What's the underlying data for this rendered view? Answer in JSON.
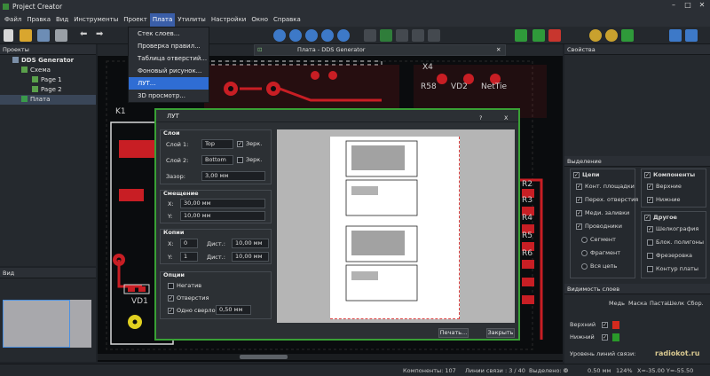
{
  "app": {
    "title": "Project Creator"
  },
  "menu": [
    "Файл",
    "Правка",
    "Вид",
    "Инструменты",
    "Проект",
    "Плата",
    "Утилиты",
    "Настройки",
    "Окно",
    "Справка"
  ],
  "plata_menu": [
    "Стек слоев...",
    "Проверка правил...",
    "Таблица отверстий...",
    "Фоновый рисунок...",
    "ЛУТ...",
    "3D просмотр..."
  ],
  "projects": {
    "title": "Проекты",
    "tree": [
      {
        "label": "DDS Generator",
        "bold": true
      },
      {
        "label": "Схема"
      },
      {
        "label": "Page 1"
      },
      {
        "label": "Page 2"
      },
      {
        "label": "Плата",
        "selected": true
      }
    ]
  },
  "view_panel": {
    "title": "Вид"
  },
  "doc_tab": {
    "label": "Плата - DDS Generator"
  },
  "pcb_labels": [
    "X4",
    "R58",
    "VD2",
    "NetTie",
    "K1",
    "VD1",
    "R2",
    "R3",
    "R4",
    "R5",
    "R6"
  ],
  "dialog": {
    "title": "ЛУТ",
    "help": "?",
    "close": "X",
    "layers": {
      "title": "Слои",
      "layer1_label": "Слой 1:",
      "layer1_value": "Top",
      "mirror1_label": "Зерк.",
      "layer2_label": "Слой 2:",
      "layer2_value": "Bottom",
      "mirror2_label": "Зерк.",
      "gap_label": "Зазор:",
      "gap_value": "3,00 мм"
    },
    "offset": {
      "title": "Смещение",
      "x_label": "X:",
      "x_value": "30,00 мм",
      "y_label": "Y:",
      "y_value": "10,00 мм"
    },
    "copies": {
      "title": "Копии",
      "x_label": "X:",
      "x_value": "0",
      "dx_label": "Дист.:",
      "dx_value": "10,00 мм",
      "y_label": "Y:",
      "y_value": "1",
      "dy_label": "Дист.:",
      "dy_value": "10,00 мм"
    },
    "options": {
      "title": "Опции",
      "negative_label": "Негатив",
      "holes_label": "Отверстия",
      "one_drill_label": "Одно сверло",
      "one_drill_value": "0,50 мм"
    },
    "print_button": "Печать...",
    "close_button": "Закрыть"
  },
  "properties": {
    "title": "Свойства"
  },
  "selection": {
    "title": "Выделение",
    "chains_title": "Цепи",
    "chains": [
      "Конт. площадки",
      "Перех. отверстия",
      "Меди. заливки",
      "Проводники",
      "Сегмент",
      "Фрагмент",
      "Вся цепь"
    ],
    "components_title": "Компоненты",
    "components": [
      "Верхние",
      "Нижние"
    ],
    "other_title": "Другое",
    "other": [
      "Шелкография",
      "Блок. полигоны",
      "Фрезеровка",
      "Контур платы"
    ]
  },
  "layer_visibility": {
    "title": "Видимость слоев",
    "columns": [
      "Медь",
      "Маска",
      "Паста",
      "Шелк",
      "Сбор."
    ],
    "rows": [
      "Верхний",
      "Нижний"
    ],
    "grid_label": "Уровень линий связи:"
  },
  "watermark": {
    "text": "radiokot.ru"
  },
  "status": {
    "components": "Компоненты: 107",
    "links": "Линии связи : 3 / 40",
    "selected": "Выделено: 0",
    "angle": "0",
    "step": "0.50 мм",
    "zoom": "124%",
    "coords": "X=-35.00  Y=-55.50"
  },
  "colors": {
    "accent": "#39a035",
    "menu_highlight": "#2f6dd4",
    "pcb_bg": "#0a0c0e",
    "copper_top": "#c81e24",
    "silk": "#e8e8e8"
  }
}
